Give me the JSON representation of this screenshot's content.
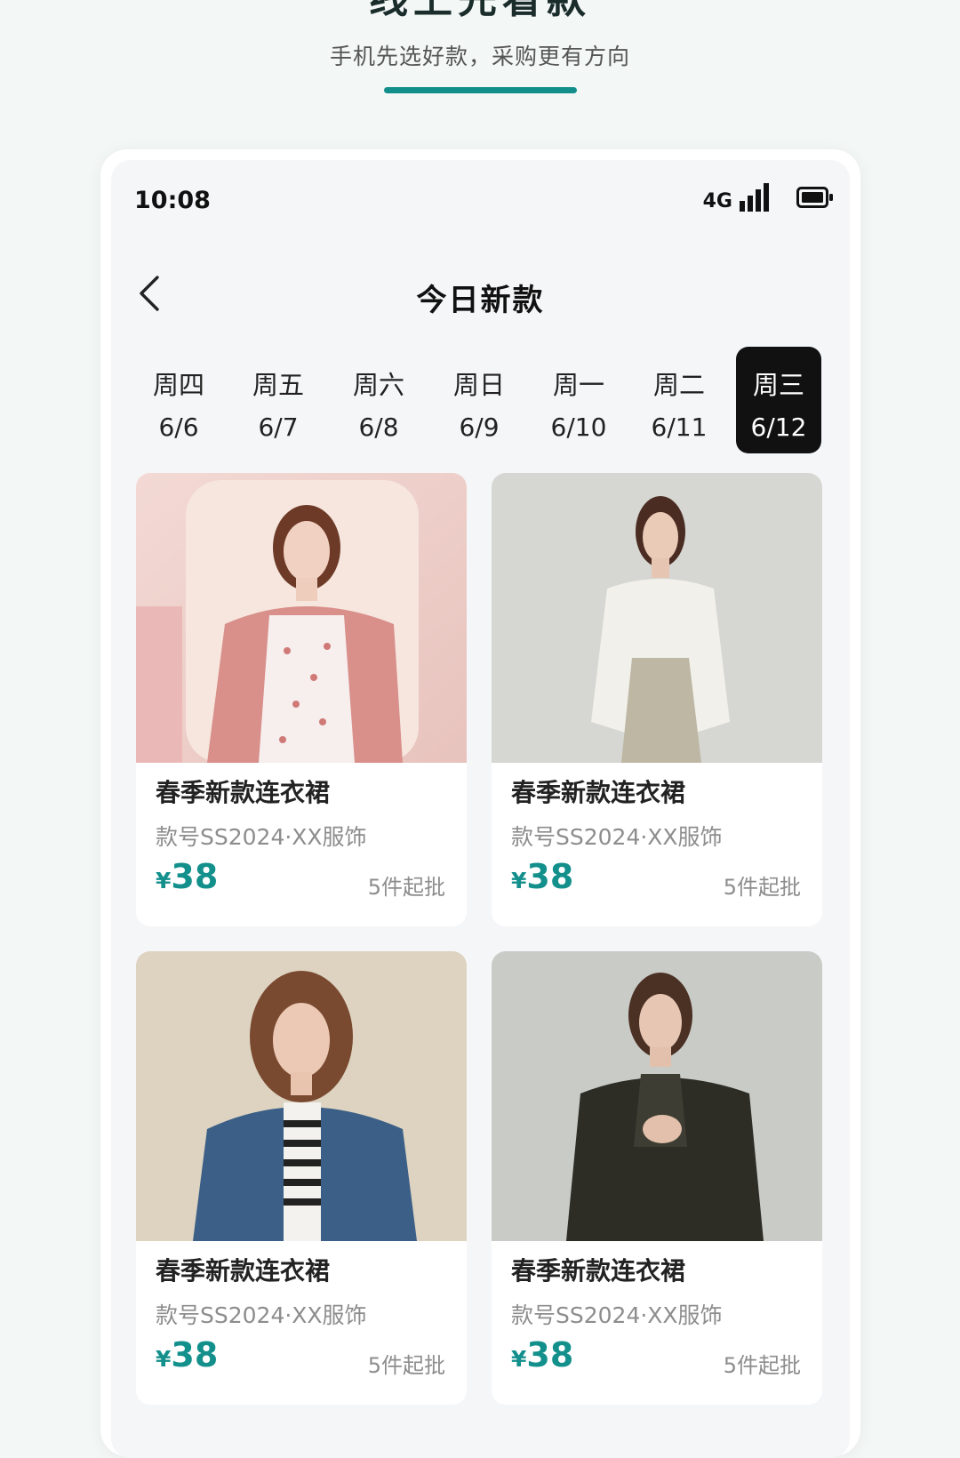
{
  "hero": {
    "title": "线上先看款",
    "subtitle": "手机先选好款，采购更有方向",
    "accent": "#138f8b"
  },
  "status_bar": {
    "time": "10:08",
    "network": "4G",
    "icons": [
      "signal-icon",
      "battery-icon"
    ]
  },
  "nav": {
    "title": "今日新款",
    "back_icon": "chevron-left-icon"
  },
  "days": [
    {
      "weekday": "周四",
      "date": "6/6",
      "active": false
    },
    {
      "weekday": "周五",
      "date": "6/7",
      "active": false
    },
    {
      "weekday": "周六",
      "date": "6/8",
      "active": false
    },
    {
      "weekday": "周日",
      "date": "6/9",
      "active": false
    },
    {
      "weekday": "周一",
      "date": "6/10",
      "active": false
    },
    {
      "weekday": "周二",
      "date": "6/11",
      "active": false
    },
    {
      "weekday": "周三",
      "date": "6/12",
      "active": true
    }
  ],
  "products": [
    {
      "name": "春季新款连衣裙",
      "sku": "款号SS2024·XX服饰",
      "currency": "¥",
      "price": "38",
      "moq": "5件起批",
      "image": "pink-cardigan-photo"
    },
    {
      "name": "春季新款连衣裙",
      "sku": "款号SS2024·XX服饰",
      "currency": "¥",
      "price": "38",
      "moq": "5件起批",
      "image": "white-blouse-photo"
    },
    {
      "name": "春季新款连衣裙",
      "sku": "款号SS2024·XX服饰",
      "currency": "¥",
      "price": "38",
      "moq": "5件起批",
      "image": "denim-jacket-photo"
    },
    {
      "name": "春季新款连衣裙",
      "sku": "款号SS2024·XX服饰",
      "currency": "¥",
      "price": "38",
      "moq": "5件起批",
      "image": "leather-jacket-photo"
    }
  ]
}
